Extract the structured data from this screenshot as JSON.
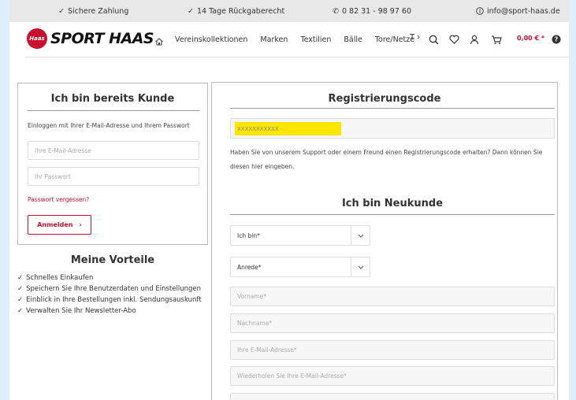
{
  "topbar": {
    "secure_payment": "Sichere Zahlung",
    "return_policy": "14 Tage Rückgaberecht",
    "phone": "0 82 31 - 98 97 60",
    "email": "info@sport-haas.de"
  },
  "header": {
    "logo_badge": "Haas",
    "logo_text": "SPORT HAAS",
    "nav": [
      "Vereinskollektionen",
      "Marken",
      "Textilien",
      "Bälle",
      "Tore/Netze"
    ],
    "nav_more": "T ›",
    "cart_price": "0,00 € *"
  },
  "login": {
    "title": "Ich bin bereits Kunde",
    "hint": "Einloggen mit Ihrer E-Mail-Adresse und Ihrem Passwort",
    "email_placeholder": "Ihre E-Mail-Adresse",
    "password_placeholder": "Ihr Passwort",
    "forgot": "Passwort vergessen?",
    "submit": "Anmelden"
  },
  "benefits": {
    "title": "Meine Vorteile",
    "items": [
      "Schnelles Einkaufen",
      "Speichern Sie Ihre Benutzerdaten und Einstellungen",
      "Einblick in Ihre Bestellungen inkl. Sendungsauskunft",
      "Verwalten Sie Ihr Newsletter-Abo"
    ]
  },
  "registration": {
    "title": "Registrierungscode",
    "code_value": "XXXXXXXXXXX",
    "hint": "Haben Sie von unserem Support oder einem Freund einen Registrierungscode erhalten? Dann können Sie diesen hier eingeben."
  },
  "newcustomer": {
    "title": "Ich bin Neukunde",
    "select_type": "Ich bin*",
    "select_salutation": "Anrede*",
    "firstname": "Vorname*",
    "lastname": "Nachname*",
    "email": "Ihre E-Mail-Adresse*",
    "email_repeat": "Wiederholen Sie Ihre E-Mail-Adresse*"
  },
  "colors": {
    "accent": "#c8102e",
    "highlight": "#ffe600"
  }
}
